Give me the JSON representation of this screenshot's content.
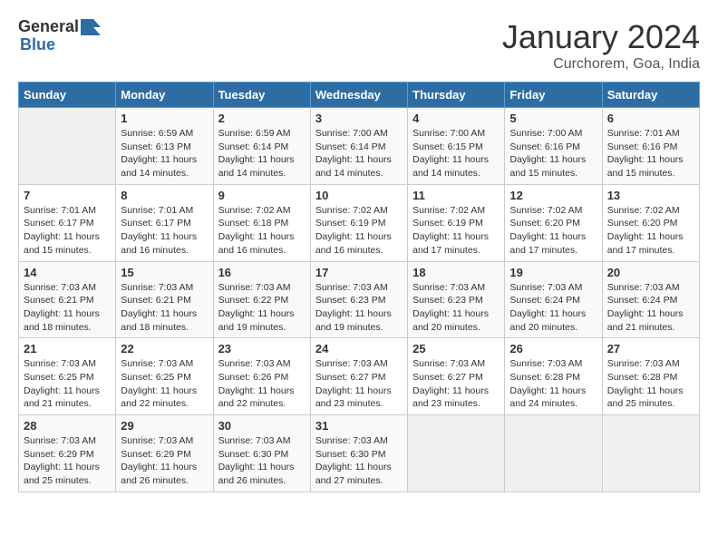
{
  "header": {
    "logo_general": "General",
    "logo_blue": "Blue",
    "title": "January 2024",
    "subtitle": "Curchorem, Goa, India"
  },
  "days_of_week": [
    "Sunday",
    "Monday",
    "Tuesday",
    "Wednesday",
    "Thursday",
    "Friday",
    "Saturday"
  ],
  "weeks": [
    [
      {
        "day": "",
        "info": ""
      },
      {
        "day": "1",
        "info": "Sunrise: 6:59 AM\nSunset: 6:13 PM\nDaylight: 11 hours\nand 14 minutes."
      },
      {
        "day": "2",
        "info": "Sunrise: 6:59 AM\nSunset: 6:14 PM\nDaylight: 11 hours\nand 14 minutes."
      },
      {
        "day": "3",
        "info": "Sunrise: 7:00 AM\nSunset: 6:14 PM\nDaylight: 11 hours\nand 14 minutes."
      },
      {
        "day": "4",
        "info": "Sunrise: 7:00 AM\nSunset: 6:15 PM\nDaylight: 11 hours\nand 14 minutes."
      },
      {
        "day": "5",
        "info": "Sunrise: 7:00 AM\nSunset: 6:16 PM\nDaylight: 11 hours\nand 15 minutes."
      },
      {
        "day": "6",
        "info": "Sunrise: 7:01 AM\nSunset: 6:16 PM\nDaylight: 11 hours\nand 15 minutes."
      }
    ],
    [
      {
        "day": "7",
        "info": "Sunrise: 7:01 AM\nSunset: 6:17 PM\nDaylight: 11 hours\nand 15 minutes."
      },
      {
        "day": "8",
        "info": "Sunrise: 7:01 AM\nSunset: 6:17 PM\nDaylight: 11 hours\nand 16 minutes."
      },
      {
        "day": "9",
        "info": "Sunrise: 7:02 AM\nSunset: 6:18 PM\nDaylight: 11 hours\nand 16 minutes."
      },
      {
        "day": "10",
        "info": "Sunrise: 7:02 AM\nSunset: 6:19 PM\nDaylight: 11 hours\nand 16 minutes."
      },
      {
        "day": "11",
        "info": "Sunrise: 7:02 AM\nSunset: 6:19 PM\nDaylight: 11 hours\nand 17 minutes."
      },
      {
        "day": "12",
        "info": "Sunrise: 7:02 AM\nSunset: 6:20 PM\nDaylight: 11 hours\nand 17 minutes."
      },
      {
        "day": "13",
        "info": "Sunrise: 7:02 AM\nSunset: 6:20 PM\nDaylight: 11 hours\nand 17 minutes."
      }
    ],
    [
      {
        "day": "14",
        "info": "Sunrise: 7:03 AM\nSunset: 6:21 PM\nDaylight: 11 hours\nand 18 minutes."
      },
      {
        "day": "15",
        "info": "Sunrise: 7:03 AM\nSunset: 6:21 PM\nDaylight: 11 hours\nand 18 minutes."
      },
      {
        "day": "16",
        "info": "Sunrise: 7:03 AM\nSunset: 6:22 PM\nDaylight: 11 hours\nand 19 minutes."
      },
      {
        "day": "17",
        "info": "Sunrise: 7:03 AM\nSunset: 6:23 PM\nDaylight: 11 hours\nand 19 minutes."
      },
      {
        "day": "18",
        "info": "Sunrise: 7:03 AM\nSunset: 6:23 PM\nDaylight: 11 hours\nand 20 minutes."
      },
      {
        "day": "19",
        "info": "Sunrise: 7:03 AM\nSunset: 6:24 PM\nDaylight: 11 hours\nand 20 minutes."
      },
      {
        "day": "20",
        "info": "Sunrise: 7:03 AM\nSunset: 6:24 PM\nDaylight: 11 hours\nand 21 minutes."
      }
    ],
    [
      {
        "day": "21",
        "info": "Sunrise: 7:03 AM\nSunset: 6:25 PM\nDaylight: 11 hours\nand 21 minutes."
      },
      {
        "day": "22",
        "info": "Sunrise: 7:03 AM\nSunset: 6:25 PM\nDaylight: 11 hours\nand 22 minutes."
      },
      {
        "day": "23",
        "info": "Sunrise: 7:03 AM\nSunset: 6:26 PM\nDaylight: 11 hours\nand 22 minutes."
      },
      {
        "day": "24",
        "info": "Sunrise: 7:03 AM\nSunset: 6:27 PM\nDaylight: 11 hours\nand 23 minutes."
      },
      {
        "day": "25",
        "info": "Sunrise: 7:03 AM\nSunset: 6:27 PM\nDaylight: 11 hours\nand 23 minutes."
      },
      {
        "day": "26",
        "info": "Sunrise: 7:03 AM\nSunset: 6:28 PM\nDaylight: 11 hours\nand 24 minutes."
      },
      {
        "day": "27",
        "info": "Sunrise: 7:03 AM\nSunset: 6:28 PM\nDaylight: 11 hours\nand 25 minutes."
      }
    ],
    [
      {
        "day": "28",
        "info": "Sunrise: 7:03 AM\nSunset: 6:29 PM\nDaylight: 11 hours\nand 25 minutes."
      },
      {
        "day": "29",
        "info": "Sunrise: 7:03 AM\nSunset: 6:29 PM\nDaylight: 11 hours\nand 26 minutes."
      },
      {
        "day": "30",
        "info": "Sunrise: 7:03 AM\nSunset: 6:30 PM\nDaylight: 11 hours\nand 26 minutes."
      },
      {
        "day": "31",
        "info": "Sunrise: 7:03 AM\nSunset: 6:30 PM\nDaylight: 11 hours\nand 27 minutes."
      },
      {
        "day": "",
        "info": ""
      },
      {
        "day": "",
        "info": ""
      },
      {
        "day": "",
        "info": ""
      }
    ]
  ]
}
